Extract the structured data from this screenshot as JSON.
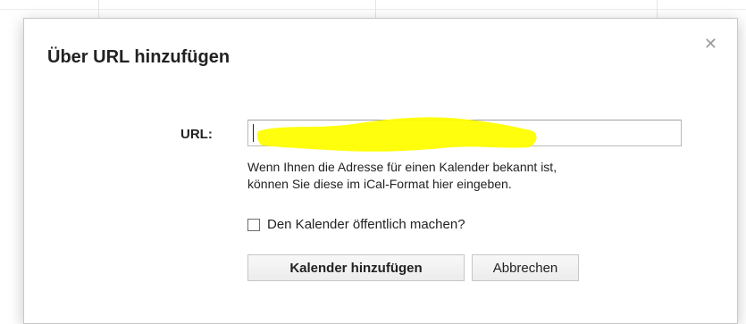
{
  "dialog": {
    "title": "Über URL hinzufügen",
    "close_icon": "close-icon",
    "url_label": "URL:",
    "url_value": "",
    "help_line1": "Wenn Ihnen die Adresse für einen Kalender bekannt ist,",
    "help_line2": "können Sie diese im iCal-Format hier eingeben.",
    "checkbox_label": "Den Kalender öffentlich machen?",
    "checkbox_checked": false,
    "add_button_label": "Kalender hinzufügen",
    "cancel_button_label": "Abbrechen",
    "highlight_color": "#ffff00"
  }
}
